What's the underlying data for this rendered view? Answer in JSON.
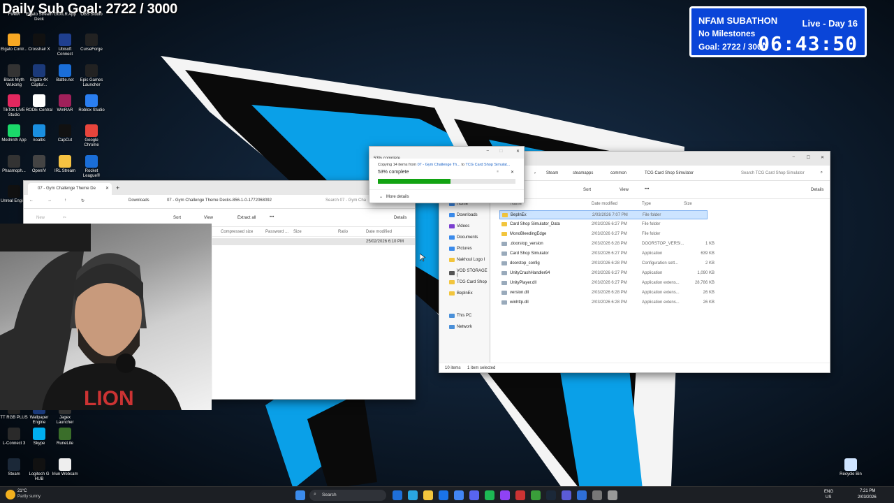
{
  "overlay": {
    "daily_goal": "Daily Sub Goal: 2722 / 3000"
  },
  "subathon": {
    "title": "NFAM SUBATHON",
    "milestones": "No Milestones",
    "goal": "Goal: 2722 / 3000",
    "live": "Live - Day 16",
    "timer": "06:43:50"
  },
  "desktop_icons": [
    {
      "label": "FiveM",
      "color": "#e85d1a"
    },
    {
      "label": "Elgato Stream Deck",
      "color": "#222"
    },
    {
      "label": "GoXLR App",
      "color": "#111"
    },
    {
      "label": "OBS Studio",
      "color": "#333"
    },
    {
      "label": "Elgato Contr...",
      "color": "#f7a823"
    },
    {
      "label": "Crosshair X",
      "color": "#111"
    },
    {
      "label": "Ubisoft Connect",
      "color": "#1f3f8f"
    },
    {
      "label": "CurseForge",
      "color": "#222"
    },
    {
      "label": "Black Myth Wukong",
      "color": "#333"
    },
    {
      "label": "Elgato 4K Captur...",
      "color": "#1b3a7a"
    },
    {
      "label": "Battle.net",
      "color": "#1a6ed8"
    },
    {
      "label": "Epic Games Launcher",
      "color": "#222"
    },
    {
      "label": "TikTok LIVE Studio",
      "color": "#e2285f"
    },
    {
      "label": "RODE Central",
      "color": "#fff"
    },
    {
      "label": "WinRAR",
      "color": "#a0205a"
    },
    {
      "label": "Roblox Studio",
      "color": "#2a7ef0"
    },
    {
      "label": "Modrinth App",
      "color": "#1bd96a"
    },
    {
      "label": "noalbs",
      "color": "#1a8fe0"
    },
    {
      "label": "CapCut",
      "color": "#111"
    },
    {
      "label": "Google Chrome",
      "color": "#e8453c"
    },
    {
      "label": "Phasmoph...",
      "color": "#333"
    },
    {
      "label": "OpenIV",
      "color": "#444"
    },
    {
      "label": "IRL Stream",
      "color": "#f5c242"
    },
    {
      "label": "Rocket League®",
      "color": "#1a6ed8"
    },
    {
      "label": "Unreal Engine",
      "color": "#111"
    },
    {
      "label": "TT RGB PLUS",
      "color": "#222"
    },
    {
      "label": "Wallpaper Engine",
      "color": "#1b3a7a"
    },
    {
      "label": "Jagex Launcher",
      "color": "#333"
    },
    {
      "label": "L-Connect 3",
      "color": "#2a2a2a"
    },
    {
      "label": "Skype",
      "color": "#00aff0"
    },
    {
      "label": "RuneLite",
      "color": "#3a6e2a"
    },
    {
      "label": "Steam",
      "color": "#1b2838"
    },
    {
      "label": "Logitech G HUB",
      "color": "#111"
    },
    {
      "label": "Iriun Webcam",
      "color": "#eee"
    },
    {
      "label": "Recycle Bin",
      "color": "#cfe4ff"
    }
  ],
  "zip_window": {
    "tab": "07 - Gym Challenge Theme De",
    "breadcrumb": [
      "Downloads",
      "07 - Gym Challenge Theme Decks-856-1-0-1772068092"
    ],
    "search": "Search 07 - Gym Cha",
    "toolbar": {
      "new": "New",
      "sort": "Sort",
      "view": "View",
      "extract": "Extract all",
      "details": "Details"
    },
    "columns": [
      "Compressed size",
      "Password ...",
      "Size",
      "Ratio",
      "Date modified"
    ],
    "row_date": "25/02/2026 6:10 PM"
  },
  "copy_dialog": {
    "title": "53% complete",
    "copying_prefix": "Copying 14 items from",
    "copying_source": "07 - Gym Challenge Th...",
    "copying_to": "to",
    "copying_dest": "TCG Card Shop Simulat...",
    "percent_text": "53% complete",
    "progress": 0.53,
    "more": "More details"
  },
  "explorer": {
    "breadcrumb": [
      "Steam",
      "steamapps",
      "common",
      "TCG Card Shop Simulator"
    ],
    "search": "Search TCG Card Shop Simulator",
    "toolbar": {
      "sort": "Sort",
      "view": "View",
      "details": "Details"
    },
    "columns": [
      "Name",
      "Date modified",
      "Type",
      "Size"
    ],
    "nav": [
      {
        "label": "Home"
      },
      {
        "label": "Downloads"
      },
      {
        "label": "Videos"
      },
      {
        "label": "Documents"
      },
      {
        "label": "Pictures"
      },
      {
        "label": "Nakhoul Logo I"
      },
      {
        "label": "VOD STORAGE ("
      },
      {
        "label": "TCG Card Shop"
      },
      {
        "label": "BepInEx"
      },
      {
        "label": "This PC"
      },
      {
        "label": "Network"
      }
    ],
    "files": [
      {
        "name": "BepInEx",
        "date": "2/03/2026 7:07 PM",
        "type": "File folder",
        "size": ""
      },
      {
        "name": "Card Shop Simulator_Data",
        "date": "2/03/2026 6:27 PM",
        "type": "File folder",
        "size": ""
      },
      {
        "name": "MonoBleedingEdge",
        "date": "2/03/2026 6:27 PM",
        "type": "File folder",
        "size": ""
      },
      {
        "name": ".doorstop_version",
        "date": "2/03/2026 6:28 PM",
        "type": "DOORSTOP_VERSI...",
        "size": "1 KB"
      },
      {
        "name": "Card Shop Simulator",
        "date": "2/03/2026 6:27 PM",
        "type": "Application",
        "size": "639 KB"
      },
      {
        "name": "doorstop_config",
        "date": "2/03/2026 6:28 PM",
        "type": "Configuration sett...",
        "size": "2 KB"
      },
      {
        "name": "UnityCrashHandler64",
        "date": "2/03/2026 6:27 PM",
        "type": "Application",
        "size": "1,090 KB"
      },
      {
        "name": "UnityPlayer.dll",
        "date": "2/03/2026 6:27 PM",
        "type": "Application extens...",
        "size": "28,786 KB"
      },
      {
        "name": "version.dll",
        "date": "2/03/2026 6:28 PM",
        "type": "Application extens...",
        "size": "26 KB"
      },
      {
        "name": "winhttp.dll",
        "date": "2/03/2026 6:28 PM",
        "type": "Application extens...",
        "size": "26 KB"
      }
    ],
    "status_items": "10 items",
    "status_selected": "1 item selected"
  },
  "taskbar": {
    "weather_temp": "21°C",
    "weather_desc": "Partly sunny",
    "search": "Search",
    "lang1": "ENG",
    "lang2": "US",
    "time": "7:21 PM",
    "date": "2/03/2026"
  }
}
